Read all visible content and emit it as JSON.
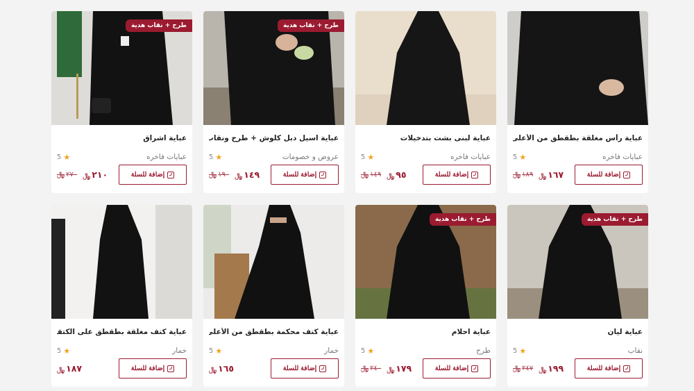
{
  "currency_symbol": "﷼",
  "add_to_cart_label": "إضافة للسلة",
  "colors": {
    "accent": "#9b1b30",
    "star": "#f2a21b",
    "background": "#f3f3f3"
  },
  "products": [
    {
      "title": "عباية رأس مغلقة بطقطق من الأعلى",
      "category": "عبايات فاخره",
      "rating": "5",
      "price": "١٦٧",
      "old_price": "١٨٩",
      "badge": "",
      "photo": {
        "bg": "#cfcdca",
        "fg": "#151515",
        "accent": "#e6e3de",
        "variant": "closeup"
      }
    },
    {
      "title": "عباية لبنى بشت بتدخيلات",
      "category": "عبايات فاخره",
      "rating": "5",
      "price": "٩٥",
      "old_price": "١٤٩",
      "badge": "",
      "photo": {
        "bg": "#e9ddcc",
        "fg": "#161616",
        "accent": "#d9c9b2",
        "variant": "full"
      }
    },
    {
      "title": "عباية اسيل دبل كلوش + طرح ونقاب هدية",
      "category": "عروض و خصومات",
      "rating": "5",
      "price": "١٤٩",
      "old_price": "١٩٠",
      "badge": "طرح + نقاب هدية",
      "photo": {
        "bg": "#b9b5ad",
        "fg": "#141414",
        "accent": "#8a8173",
        "variant": "hands"
      }
    },
    {
      "title": "عباية اشراق",
      "category": "عبايات فاخره",
      "rating": "5",
      "price": "٢١٠",
      "old_price": "٢٧٠",
      "badge": "طرح + نقاب هدية",
      "photo": {
        "bg": "#dedcd8",
        "fg": "#121212",
        "accent": "#2f6b3a",
        "variant": "flag"
      }
    },
    {
      "title": "عباية ليان",
      "category": "نقاب",
      "rating": "5",
      "price": "١٩٩",
      "old_price": "٢٤٧",
      "badge": "طرح + نقاب هدية",
      "photo": {
        "bg": "#cbc6bd",
        "fg": "#121212",
        "accent": "#7b6b55",
        "variant": "full"
      }
    },
    {
      "title": "عباية احلام",
      "category": "طرح",
      "rating": "5",
      "price": "١٧٩",
      "old_price": "٢٤٠",
      "badge": "طرح + نقاب هدية",
      "photo": {
        "bg": "#8a6a4a",
        "fg": "#111111",
        "accent": "#4f7a3a",
        "variant": "full"
      }
    },
    {
      "title": "عباية كتف محكمة بطقطق من الأعلى",
      "category": "خمار",
      "rating": "5",
      "price": "١٦٥",
      "old_price": "",
      "badge": "",
      "photo": {
        "bg": "#ecebea",
        "fg": "#111111",
        "accent": "#a47a4d",
        "variant": "seated"
      }
    },
    {
      "title": "عباية كتف مغلقة بطقطق على الكتف",
      "category": "خمار",
      "rating": "5",
      "price": "١٨٧",
      "old_price": "",
      "badge": "",
      "photo": {
        "bg": "#f2f1ef",
        "fg": "#121212",
        "accent": "#dcdad6",
        "variant": "niqab"
      }
    }
  ]
}
